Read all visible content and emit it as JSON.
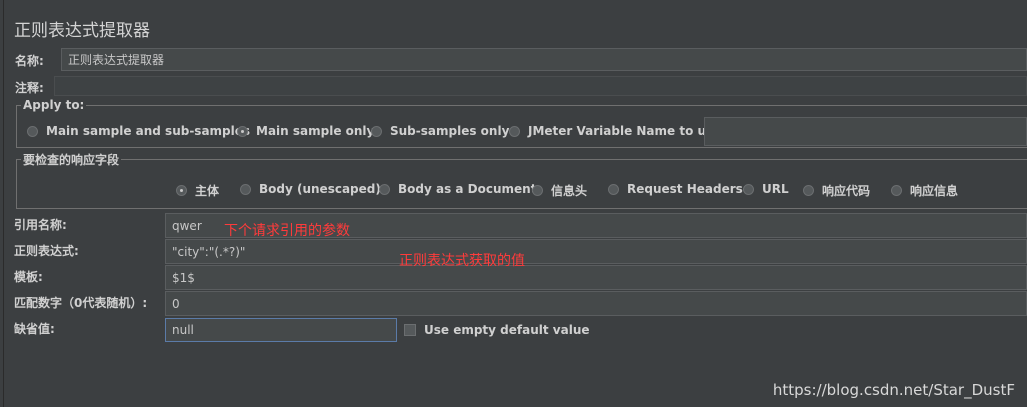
{
  "panel": {
    "title": "正则表达式提取器"
  },
  "name_row": {
    "label": "名称:",
    "value": "正则表达式提取器"
  },
  "comment_row": {
    "label": "注释:",
    "value": ""
  },
  "apply_to": {
    "legend": "Apply to:",
    "options": [
      "Main sample and sub-samples",
      "Main sample only",
      "Sub-samples only",
      "JMeter Variable Name to use"
    ],
    "selected": "Main sample only",
    "variable_value": ""
  },
  "field_check": {
    "legend": "要检查的响应字段",
    "options": [
      "主体",
      "Body (unescaped)",
      "Body as a Document",
      "信息头",
      "Request Headers",
      "URL",
      "响应代码",
      "响应信息"
    ],
    "selected": "主体"
  },
  "form": {
    "ref_name": {
      "label": "引用名称:",
      "value": "qwer"
    },
    "regex": {
      "label": "正则表达式:",
      "value": "\"city\":\"(.*?)\""
    },
    "template": {
      "label": "模板:",
      "value": "$1$"
    },
    "match_no": {
      "label": "匹配数字（0代表随机）:",
      "value": "0"
    },
    "default": {
      "label": "缺省值:",
      "value": "null"
    },
    "use_empty_label": "Use empty default value"
  },
  "annotations": {
    "ref_note": "下个请求引用的参数",
    "regex_note": "正则表达式获取的值"
  },
  "watermark": "https://blog.csdn.net/Star_DustF"
}
